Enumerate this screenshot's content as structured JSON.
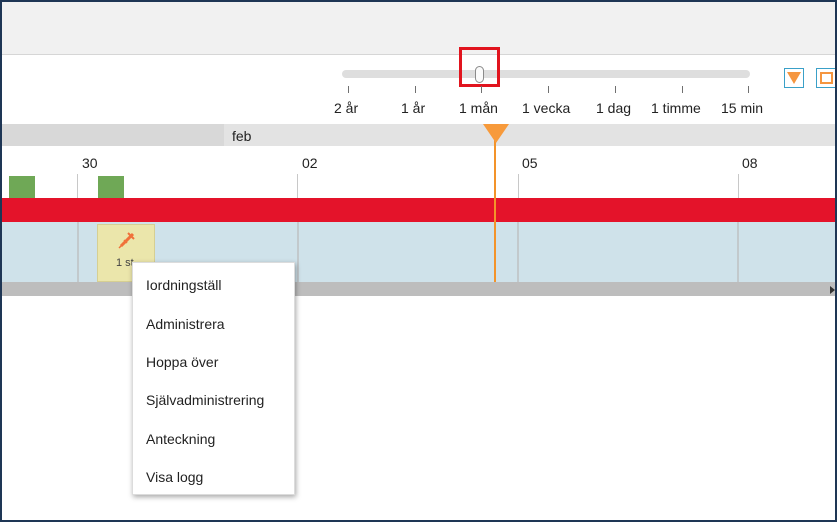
{
  "zoom": {
    "labels": [
      "2 år",
      "1 år",
      "1 mån",
      "1 vecka",
      "1 dag",
      "1 timme",
      "15 min"
    ],
    "selected": "1 mån"
  },
  "controls": {
    "filter_icon": "triangle-down-filter-icon",
    "select_icon": "square-select-icon"
  },
  "timeline": {
    "month": "feb",
    "days": [
      "30",
      "02",
      "05",
      "08"
    ]
  },
  "event": {
    "icon": "syringe-icon",
    "label": "1 st"
  },
  "context_menu": {
    "items": [
      "Iordningställ",
      "Administrera",
      "Hoppa över",
      "Självadministrering",
      "Anteckning",
      "Visa logg"
    ]
  },
  "colors": {
    "accent": "#f79a3b",
    "red_band": "#e4132a",
    "highlight_box": "#e1141e",
    "green_block": "#6fa856",
    "blue_band": "#cfe2ea"
  }
}
